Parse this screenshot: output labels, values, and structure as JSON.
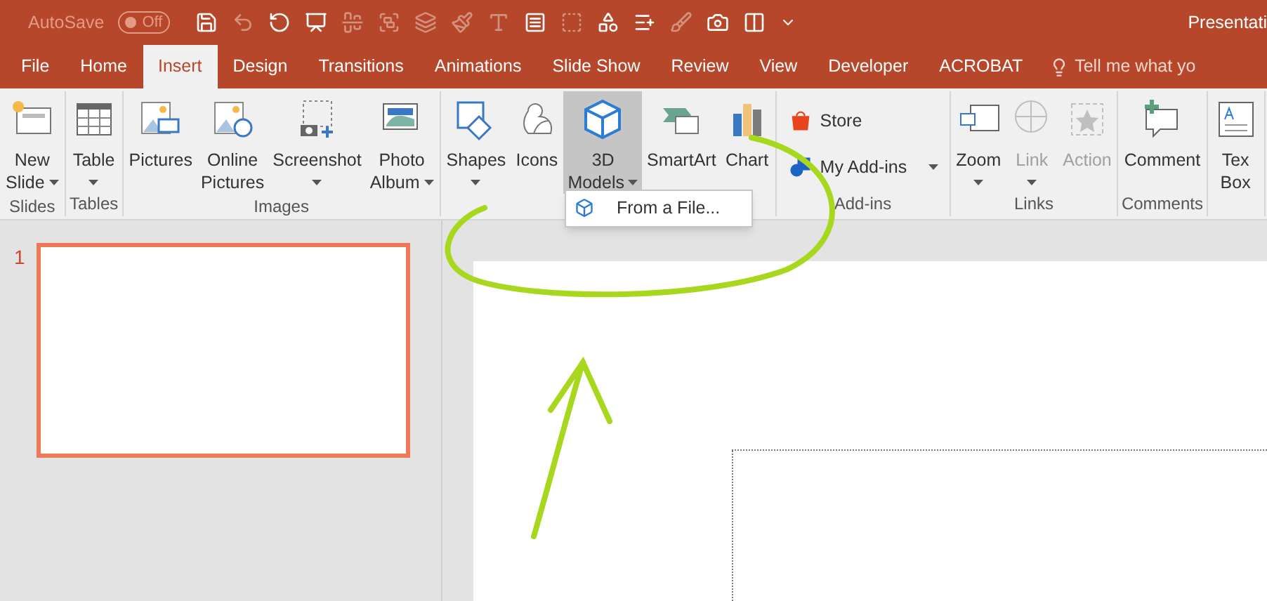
{
  "title_bar": {
    "autosave_label": "AutoSave",
    "autosave_toggle": {
      "text": "Off",
      "on": false
    },
    "title": "Presentati"
  },
  "tabs": [
    {
      "label": "File",
      "selected": false
    },
    {
      "label": "Home",
      "selected": false
    },
    {
      "label": "Insert",
      "selected": true
    },
    {
      "label": "Design",
      "selected": false
    },
    {
      "label": "Transitions",
      "selected": false
    },
    {
      "label": "Animations",
      "selected": false
    },
    {
      "label": "Slide Show",
      "selected": false
    },
    {
      "label": "Review",
      "selected": false
    },
    {
      "label": "View",
      "selected": false
    },
    {
      "label": "Developer",
      "selected": false
    },
    {
      "label": "ACROBAT",
      "selected": false
    }
  ],
  "tell_me": "Tell me what yo",
  "ribbon_groups": [
    {
      "label": "Slides",
      "buttons": [
        {
          "kind": "large",
          "lines": [
            "New",
            "Slide"
          ],
          "has_menu": true,
          "arrow_below": false,
          "disabled": false,
          "selected": false
        }
      ]
    },
    {
      "label": "Tables",
      "buttons": [
        {
          "kind": "large",
          "lines": [
            "Table"
          ],
          "has_menu": true,
          "arrow_below": true,
          "disabled": false,
          "selected": false
        }
      ]
    },
    {
      "label": "Images",
      "buttons": [
        {
          "kind": "large",
          "lines": [
            "Pictures"
          ],
          "has_menu": false,
          "disabled": false,
          "selected": false
        },
        {
          "kind": "large",
          "lines": [
            "Online",
            "Pictures"
          ],
          "has_menu": false,
          "disabled": false,
          "selected": false
        },
        {
          "kind": "large",
          "lines": [
            "Screenshot"
          ],
          "has_menu": true,
          "arrow_below": true,
          "disabled": false,
          "selected": false
        },
        {
          "kind": "large",
          "lines": [
            "Photo",
            "Album"
          ],
          "has_menu": true,
          "arrow_below": false,
          "disabled": false,
          "selected": false
        }
      ]
    },
    {
      "buttons": [
        {
          "kind": "large",
          "lines": [
            "Shapes"
          ],
          "has_menu": true,
          "arrow_below": true,
          "disabled": false,
          "selected": false
        },
        {
          "kind": "large",
          "lines": [
            "Icons"
          ],
          "has_menu": false,
          "disabled": false,
          "selected": false
        },
        {
          "kind": "large",
          "lines": [
            "3D",
            "Models"
          ],
          "has_menu": true,
          "arrow_below": false,
          "disabled": false,
          "selected": true
        },
        {
          "kind": "large",
          "lines": [
            "SmartArt"
          ],
          "has_menu": false,
          "disabled": false,
          "selected": false
        },
        {
          "kind": "large",
          "lines": [
            "Chart"
          ],
          "has_menu": false,
          "disabled": false,
          "selected": false
        }
      ]
    },
    {
      "label": "Add-ins",
      "buttons": [
        {
          "kind": "small",
          "lines": [
            "Store"
          ],
          "has_menu": false,
          "disabled": false,
          "selected": false
        },
        {
          "kind": "small",
          "lines": [
            "My Add-ins"
          ],
          "has_menu": true,
          "disabled": false,
          "selected": false
        }
      ]
    },
    {
      "label": "Links",
      "buttons": [
        {
          "kind": "large",
          "lines": [
            "Zoom"
          ],
          "has_menu": true,
          "arrow_below": true,
          "disabled": false,
          "selected": false
        },
        {
          "kind": "large",
          "lines": [
            "Link"
          ],
          "has_menu": true,
          "arrow_below": true,
          "disabled": true,
          "selected": false
        },
        {
          "kind": "large",
          "lines": [
            "Action"
          ],
          "has_menu": false,
          "disabled": true,
          "selected": false
        }
      ]
    },
    {
      "label": "Comments",
      "buttons": [
        {
          "kind": "large",
          "lines": [
            "Comment"
          ],
          "has_menu": false,
          "disabled": false,
          "selected": false
        }
      ]
    },
    {
      "buttons": [
        {
          "kind": "large",
          "lines": [
            "Tex",
            "Box"
          ],
          "has_menu": false,
          "disabled": false,
          "selected": false
        }
      ]
    }
  ],
  "dropdown_menu": {
    "items": [
      {
        "label": "From a File..."
      }
    ]
  },
  "slide_panel": {
    "thumbnails": [
      {
        "number": "1",
        "selected": true
      }
    ]
  }
}
